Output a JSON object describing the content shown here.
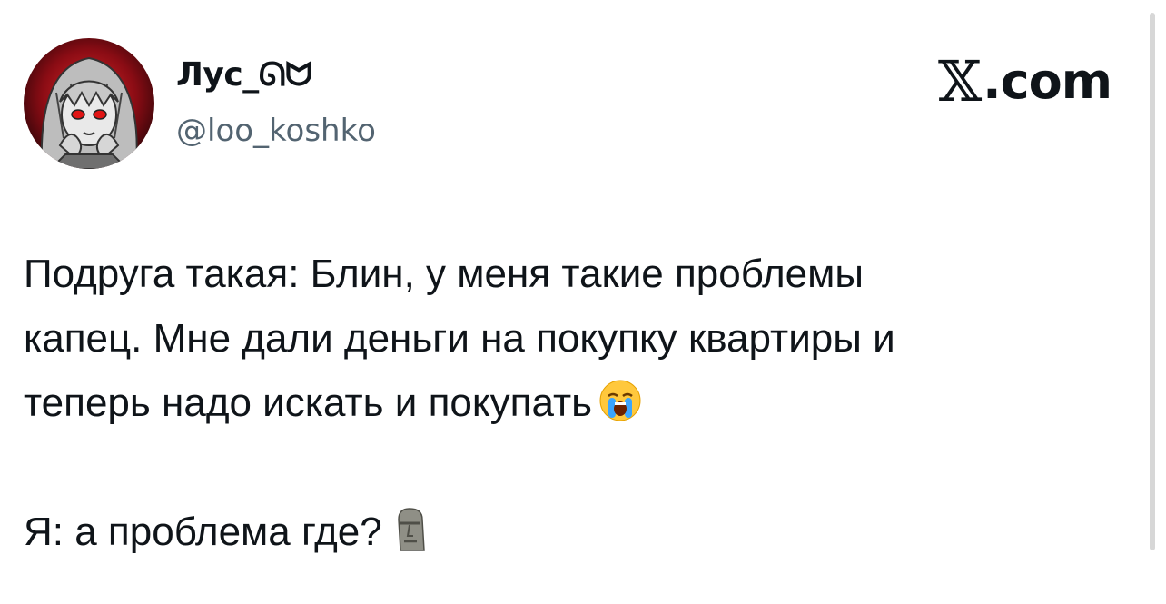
{
  "tweet": {
    "display_name": "Лус_ᘏᗢ",
    "handle": "@loo_koshko",
    "brand_text": ".com",
    "brand_logo_glyph": "𝕏",
    "paragraph_1": [
      "Подруга такая: Блин, у меня такие проблемы",
      "капец. Мне дали деньги на покупку квартиры и",
      "теперь надо искать и покупать"
    ],
    "paragraph_2": "Я: а проблема где?",
    "emoji_1": "loudly-crying-face-emoji",
    "emoji_2": "moai-emoji"
  },
  "colors": {
    "text": "#0f1419",
    "secondary_text": "#536471",
    "background": "#ffffff",
    "avatar_accent": "#b3101c"
  }
}
